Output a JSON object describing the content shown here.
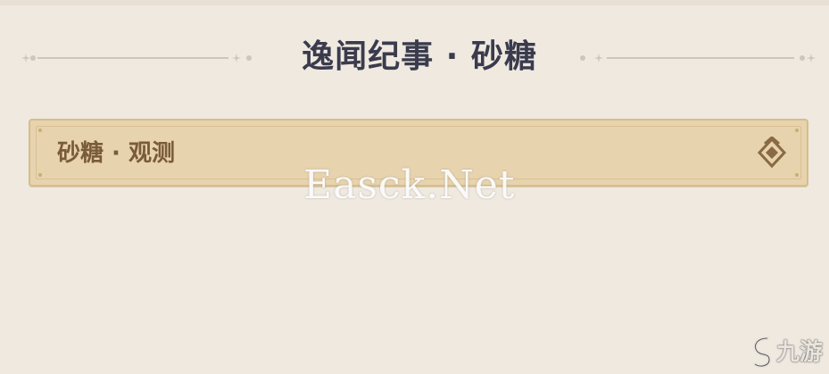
{
  "header": {
    "title": "逸闻纪事 · 砂糖"
  },
  "entry": {
    "label": "砂糖 · 观测",
    "icon": "diamond-chevron-up-icon"
  },
  "watermark": {
    "text": "Easck.Net"
  },
  "logo": {
    "text": "九游",
    "icon": "nine-game-logo-icon"
  },
  "colors": {
    "background": "#efe9e0",
    "title": "#3a3b4d",
    "entry_fill": "#e7d3ad",
    "entry_border": "#d6be8c",
    "entry_text": "#7a5b3a"
  }
}
